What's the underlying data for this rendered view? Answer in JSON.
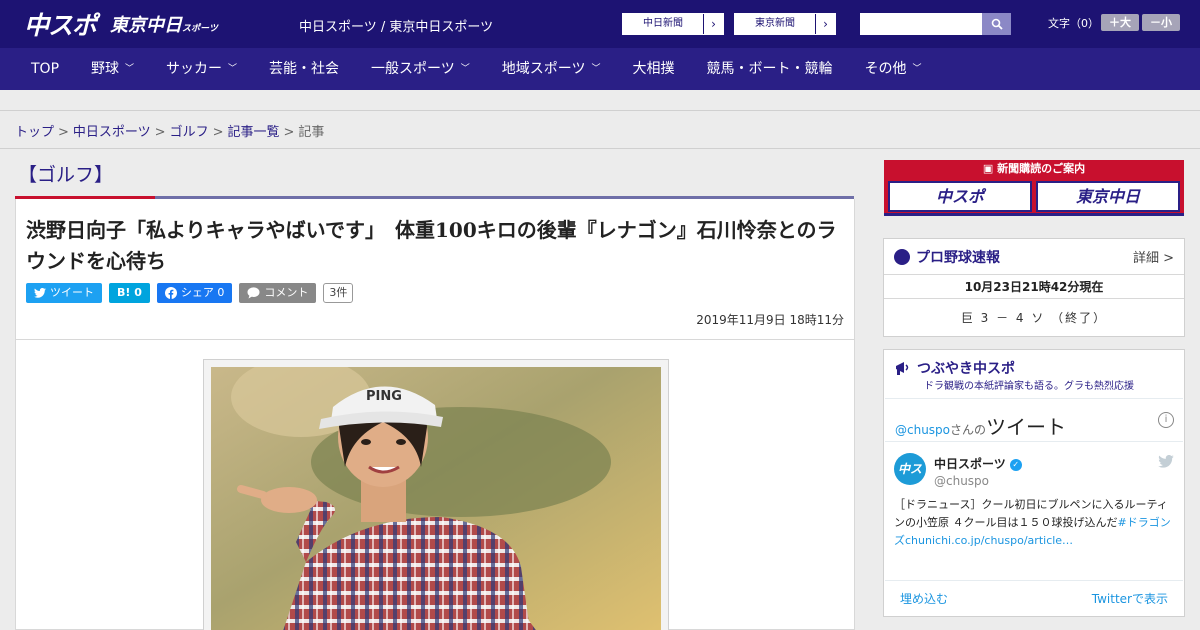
{
  "header": {
    "logo_main": "中スポ",
    "logo_sub": "東京中日",
    "logo_sub_small": "スポーツ",
    "site_label": "中日スポーツ / 東京中日スポーツ",
    "site_links": [
      {
        "label": "中日新聞",
        "arrow": "›"
      },
      {
        "label": "東京新聞",
        "arrow": "›"
      }
    ],
    "search_placeholder": "",
    "fontsize_label": "文字（0）",
    "fontsize_up": "＋大",
    "fontsize_down": "－小"
  },
  "nav": {
    "items": [
      {
        "label": "TOP",
        "has_menu": false
      },
      {
        "label": "野球",
        "has_menu": true
      },
      {
        "label": "サッカー",
        "has_menu": true
      },
      {
        "label": "芸能・社会",
        "has_menu": false
      },
      {
        "label": "一般スポーツ",
        "has_menu": true
      },
      {
        "label": "地域スポーツ",
        "has_menu": true
      },
      {
        "label": "大相撲",
        "has_menu": false
      },
      {
        "label": "競馬・ボート・競輪",
        "has_menu": false
      },
      {
        "label": "その他",
        "has_menu": true
      }
    ],
    "chevron": "﹀"
  },
  "breadcrumb": {
    "items": [
      "トップ",
      "中日スポーツ",
      "ゴルフ",
      "記事一覧"
    ],
    "current": "記事",
    "sep": ">"
  },
  "article": {
    "category": "【ゴルフ】",
    "title": "渋野日向子「私よりキャラやばいです」　体重100キロの後輩『レナゴン』石川怜奈とのラウンドを心待ち",
    "share": {
      "tweet": "ツイート",
      "hatena": "B! 0",
      "facebook": "シェア 0",
      "comment": "コメント",
      "comment_count": "3件"
    },
    "date": "2019年11月9日 18時11分"
  },
  "sidebar": {
    "promo_top": "新聞購読のご案内",
    "promo_logos": [
      "中スポ",
      "東京中日"
    ],
    "baseball": {
      "title": "プロ野球速報",
      "detail": "詳細 >",
      "time": "10月23日21時42分現在",
      "score": "巨 3 － 4 ソ （終了）"
    },
    "tsubuyaki": {
      "title": "つぶやき中スポ",
      "subtitle": "ドラ観戦の本紙評論家も語る。グラも熱烈応援",
      "handle": "@chuspo",
      "handle_suffix": "さんの",
      "tweet_word": "ツイート",
      "info": "i",
      "avatar": "中スポ",
      "name": "中日スポーツ",
      "screen_name": "@chuspo",
      "text": "［ドラニュース］クール初日にブルペンに入るルーティンの小笠原 ４クール目は１５０球投げ込んだ",
      "text_link": "#ドラゴンズchunichi.co.jp/chuspo/article…",
      "embed": "埋め込む",
      "view": "Twitterで表示"
    }
  },
  "colors": {
    "brand_navy": "#1d1373",
    "nav_bg": "#2a1f86",
    "accent_red": "#c8102e",
    "twitter_blue": "#1da1f2"
  }
}
